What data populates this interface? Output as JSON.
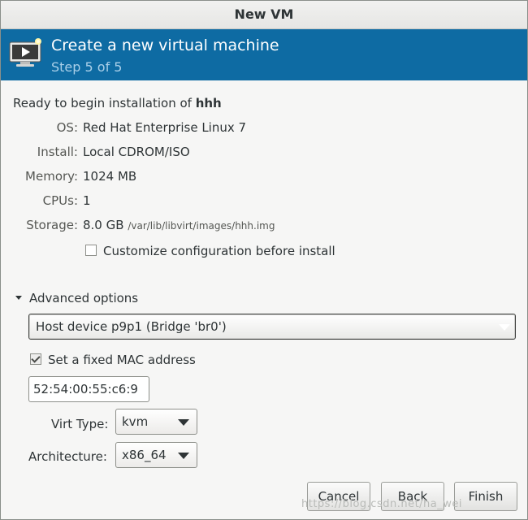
{
  "window": {
    "title": "New VM"
  },
  "header": {
    "title": "Create a new virtual machine",
    "step": "Step 5 of 5",
    "icon": "monitor-play-icon"
  },
  "summary": {
    "ready_prefix": "Ready to begin installation of ",
    "vm_name": "hhh",
    "rows": [
      {
        "label": "OS:",
        "value": "Red Hat Enterprise Linux 7"
      },
      {
        "label": "Install:",
        "value": "Local CDROM/ISO"
      },
      {
        "label": "Memory:",
        "value": "1024 MB"
      },
      {
        "label": "CPUs:",
        "value": "1"
      },
      {
        "label": "Storage:",
        "value": "8.0 GB",
        "path": "/var/lib/libvirt/images/hhh.img"
      }
    ],
    "customize": {
      "label": "Customize configuration before install",
      "checked": false
    }
  },
  "advanced": {
    "label": "Advanced options",
    "network_device": "Host device p9p1 (Bridge 'br0')",
    "fixed_mac": {
      "label": "Set a fixed MAC address",
      "checked": true
    },
    "mac_value": "52:54:00:55:c6:9",
    "virt_type": {
      "label": "Virt Type:",
      "value": "kvm"
    },
    "architecture": {
      "label": "Architecture:",
      "value": "x86_64"
    }
  },
  "buttons": {
    "cancel": "Cancel",
    "back": "Back",
    "finish": "Finish"
  },
  "watermark": "https://blog.csdn.net/ha_wei"
}
